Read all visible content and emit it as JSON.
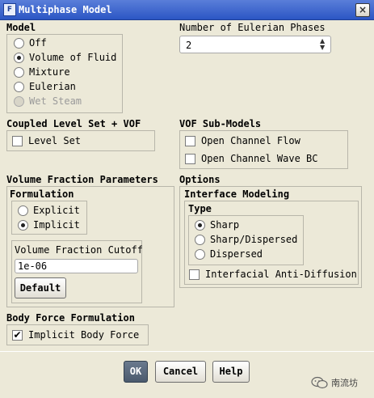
{
  "window": {
    "title": "Multiphase Model",
    "app_icon_glyph": "F",
    "close_glyph": "×"
  },
  "model": {
    "title": "Model",
    "options": [
      {
        "label": "Off",
        "selected": false,
        "enabled": true
      },
      {
        "label": "Volume of Fluid",
        "selected": true,
        "enabled": true
      },
      {
        "label": "Mixture",
        "selected": false,
        "enabled": true
      },
      {
        "label": "Eulerian",
        "selected": false,
        "enabled": true
      },
      {
        "label": "Wet Steam",
        "selected": false,
        "enabled": false
      }
    ]
  },
  "phases": {
    "title": "Number of Eulerian Phases",
    "value": "2",
    "up_glyph": "▲",
    "down_glyph": "▼"
  },
  "coupled": {
    "title": "Coupled Level Set + VOF",
    "level_set_label": "Level Set",
    "level_set_checked": false
  },
  "vof_submodels": {
    "title": "VOF Sub-Models",
    "open_channel_flow_label": "Open Channel Flow",
    "open_channel_wave_bc_label": "Open Channel Wave BC"
  },
  "vf_params": {
    "title": "Volume Fraction Parameters",
    "formulation_title": "Formulation",
    "explicit_label": "Explicit",
    "implicit_label": "Implicit",
    "selected": "Implicit",
    "cutoff_title": "Volume Fraction Cutoff",
    "cutoff_value": "1e-06",
    "default_button": "Default"
  },
  "options": {
    "title": "Options",
    "interface_title": "Interface Modeling",
    "type_title": "Type",
    "types": [
      {
        "label": "Sharp",
        "selected": true
      },
      {
        "label": "Sharp/Dispersed",
        "selected": false
      },
      {
        "label": "Dispersed",
        "selected": false
      }
    ],
    "anti_diffusion_label": "Interfacial Anti-Diffusion",
    "anti_diffusion_checked": false
  },
  "body_force": {
    "title": "Body Force Formulation",
    "implicit_label": "Implicit Body Force",
    "implicit_checked": true,
    "check_glyph": "✔"
  },
  "buttons": {
    "ok": "OK",
    "cancel": "Cancel",
    "help": "Help"
  },
  "watermark": {
    "text": "南流坊",
    "icon": "wechat-icon"
  }
}
